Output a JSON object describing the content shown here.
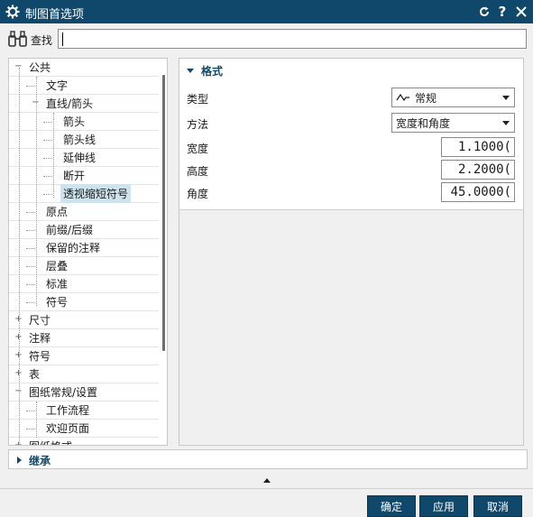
{
  "window": {
    "title": "制图首选项",
    "app_icon": "gear-icon",
    "reset_icon": "reset-icon",
    "help_icon": "help-icon",
    "close_icon": "close-icon"
  },
  "search": {
    "label": "查找",
    "value": "",
    "icon": "binoculars-icon"
  },
  "tree": {
    "items": [
      {
        "label": "公共",
        "level": 0,
        "toggle": "−"
      },
      {
        "label": "文字",
        "level": 1
      },
      {
        "label": "直线/箭头",
        "level": 1,
        "toggle": "−"
      },
      {
        "label": "箭头",
        "level": 2
      },
      {
        "label": "箭头线",
        "level": 2
      },
      {
        "label": "延伸线",
        "level": 2
      },
      {
        "label": "断开",
        "level": 2
      },
      {
        "label": "透视缩短符号",
        "level": 2,
        "selected": true
      },
      {
        "label": "原点",
        "level": 1
      },
      {
        "label": "前缀/后缀",
        "level": 1
      },
      {
        "label": "保留的注释",
        "level": 1
      },
      {
        "label": "层叠",
        "level": 1
      },
      {
        "label": "标准",
        "level": 1
      },
      {
        "label": "符号",
        "level": 1
      },
      {
        "label": "尺寸",
        "level": 0,
        "toggle": "+"
      },
      {
        "label": "注释",
        "level": 0,
        "toggle": "+"
      },
      {
        "label": "符号",
        "level": 0,
        "toggle": "+"
      },
      {
        "label": "表",
        "level": 0,
        "toggle": "+"
      },
      {
        "label": "图纸常规/设置",
        "level": 0,
        "toggle": "−"
      },
      {
        "label": "工作流程",
        "level": 1
      },
      {
        "label": "欢迎页面",
        "level": 1
      },
      {
        "label": "图纸格式",
        "level": 0,
        "toggle": "+"
      }
    ]
  },
  "format_section": {
    "title": "格式",
    "type_label": "类型",
    "type_value": "常规",
    "type_icon": "wave-line-icon",
    "method_label": "方法",
    "method_value": "宽度和角度",
    "width_label": "宽度",
    "width_value": "1.1000(",
    "height_label": "高度",
    "height_value": "2.2000(",
    "angle_label": "角度",
    "angle_value": "45.0000("
  },
  "inherit_section": {
    "title": "继承"
  },
  "buttons": {
    "ok": "确定",
    "apply": "应用",
    "cancel": "取消"
  },
  "colors": {
    "accent": "#10486b",
    "selected": "#cde4ef"
  }
}
